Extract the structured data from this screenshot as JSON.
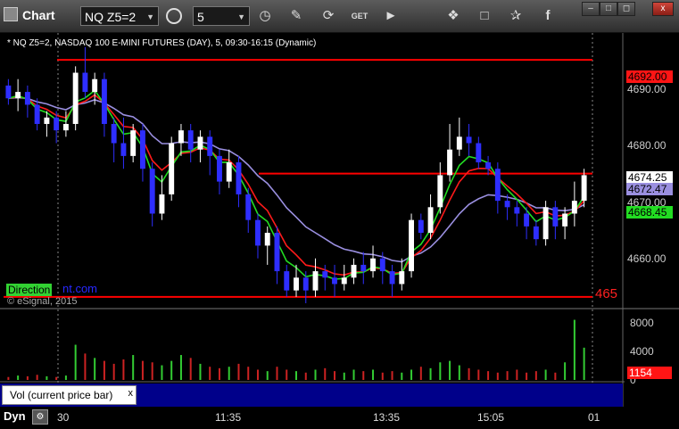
{
  "app": {
    "title": "Chart"
  },
  "toolbar": {
    "symbol": "NQ Z5=2",
    "interval": "5",
    "icons": [
      "gear-icon",
      "clock-icon",
      "pencil-icon",
      "refresh-icon",
      "get-icon",
      "play-icon",
      "link-icon",
      "message-icon",
      "twitter-icon",
      "facebook-icon"
    ]
  },
  "chart": {
    "caption": "* NQ Z5=2, NASDAQ 100 E-MINI FUTURES (DAY), 5, 09:30-16:15 (Dynamic)",
    "watermark_badge": "Direction",
    "watermark_tail": "nt.com",
    "copyright": "© eSignal, 2015",
    "right_edge_label": "465",
    "price_ticks": [
      "4690.00",
      "4680.00",
      "4670.00",
      "4660.00"
    ],
    "price_tags": {
      "resistance": "4692.00",
      "last": "4674.25",
      "ma_purple": "4672.47",
      "ma_green": "4668.45"
    },
    "volume_ticks": [
      "8000",
      "4000",
      "0"
    ],
    "volume_tag": "1154",
    "time_ticks": [
      "30",
      "11:35",
      "13:35",
      "15:05",
      "01"
    ],
    "volume_panel_title": "Vol (current price bar)",
    "dyn_label": "Dyn",
    "colors": {
      "up": "#ffffff",
      "down": "#2e2eff",
      "ma_red": "#ff1a1a",
      "ma_green": "#22dd22",
      "ma_purple": "#9a8fe0",
      "level": "#ff0000"
    }
  },
  "chart_data": {
    "type": "candlestick",
    "y_unit": "price",
    "ylim": [
      4654,
      4693
    ],
    "levels": [
      4692.0,
      4674.25,
      4655.0
    ],
    "candles": [
      [
        4688,
        4686,
        4689,
        4685
      ],
      [
        4686,
        4687,
        4689,
        4684
      ],
      [
        4687,
        4685,
        4688,
        4683
      ],
      [
        4685,
        4682,
        4686,
        4681
      ],
      [
        4682,
        4683,
        4684,
        4680
      ],
      [
        4683,
        4681,
        4684,
        4679
      ],
      [
        4681,
        4682,
        4684,
        4680
      ],
      [
        4682,
        4690,
        4691,
        4681
      ],
      [
        4690,
        4687,
        4694,
        4686
      ],
      [
        4687,
        4689,
        4690,
        4685
      ],
      [
        4689,
        4682,
        4690,
        4680
      ],
      [
        4682,
        4679,
        4683,
        4676
      ],
      [
        4679,
        4677,
        4683,
        4675
      ],
      [
        4677,
        4681,
        4682,
        4676
      ],
      [
        4681,
        4675,
        4682,
        4673
      ],
      [
        4675,
        4668,
        4676,
        4666
      ],
      [
        4668,
        4671,
        4674,
        4667
      ],
      [
        4671,
        4679,
        4680,
        4670
      ],
      [
        4679,
        4681,
        4682,
        4677
      ],
      [
        4681,
        4678,
        4682,
        4676
      ],
      [
        4678,
        4680,
        4681,
        4676
      ],
      [
        4680,
        4677,
        4681,
        4674
      ],
      [
        4677,
        4673,
        4678,
        4671
      ],
      [
        4673,
        4676,
        4678,
        4672
      ],
      [
        4676,
        4671,
        4677,
        4669
      ],
      [
        4671,
        4667,
        4672,
        4665
      ],
      [
        4667,
        4663,
        4668,
        4661
      ],
      [
        4663,
        4665,
        4666,
        4660
      ],
      [
        4665,
        4659,
        4666,
        4657
      ],
      [
        4659,
        4656,
        4660,
        4655
      ],
      [
        4656,
        4658,
        4660,
        4655
      ],
      [
        4658,
        4656,
        4659,
        4654
      ],
      [
        4656,
        4659,
        4661,
        4655
      ],
      [
        4659,
        4658,
        4660,
        4656
      ],
      [
        4658,
        4657,
        4660,
        4655
      ],
      [
        4657,
        4658,
        4660,
        4656
      ],
      [
        4658,
        4660,
        4661,
        4657
      ],
      [
        4660,
        4659,
        4662,
        4657
      ],
      [
        4659,
        4661,
        4663,
        4658
      ],
      [
        4661,
        4659,
        4662,
        4657
      ],
      [
        4659,
        4657,
        4660,
        4655
      ],
      [
        4657,
        4659,
        4661,
        4656
      ],
      [
        4659,
        4667,
        4668,
        4658
      ],
      [
        4667,
        4665,
        4668,
        4664
      ],
      [
        4665,
        4669,
        4671,
        4664
      ],
      [
        4669,
        4674,
        4676,
        4668
      ],
      [
        4674,
        4678,
        4682,
        4673
      ],
      [
        4678,
        4680,
        4683,
        4677
      ],
      [
        4680,
        4679,
        4682,
        4677
      ],
      [
        4679,
        4676,
        4680,
        4675
      ],
      [
        4676,
        4675,
        4677,
        4674
      ],
      [
        4675,
        4670,
        4676,
        4668
      ],
      [
        4670,
        4669,
        4671,
        4667
      ],
      [
        4669,
        4668,
        4670,
        4666
      ],
      [
        4668,
        4666,
        4669,
        4664
      ],
      [
        4666,
        4664,
        4667,
        4663
      ],
      [
        4664,
        4669,
        4670,
        4663
      ],
      [
        4669,
        4666,
        4670,
        4664
      ],
      [
        4666,
        4668,
        4669,
        4664
      ],
      [
        4668,
        4670,
        4673,
        4666
      ],
      [
        4670,
        4674,
        4675,
        4669
      ]
    ],
    "volume": [
      400,
      600,
      500,
      700,
      500,
      400,
      600,
      4800,
      3600,
      3000,
      2600,
      2200,
      2800,
      3400,
      2600,
      2400,
      2000,
      2600,
      3400,
      3000,
      2200,
      1800,
      1600,
      1800,
      2200,
      1800,
      1400,
      1200,
      1800,
      1400,
      1200,
      1000,
      1400,
      1600,
      1200,
      1000,
      1400,
      1200,
      1400,
      1000,
      1200,
      1000,
      1400,
      1800,
      1600,
      2400,
      2600,
      2000,
      1600,
      1400,
      1200,
      1000,
      1200,
      1400,
      1000,
      1200,
      1400,
      1000,
      2400,
      8200,
      4400
    ]
  }
}
